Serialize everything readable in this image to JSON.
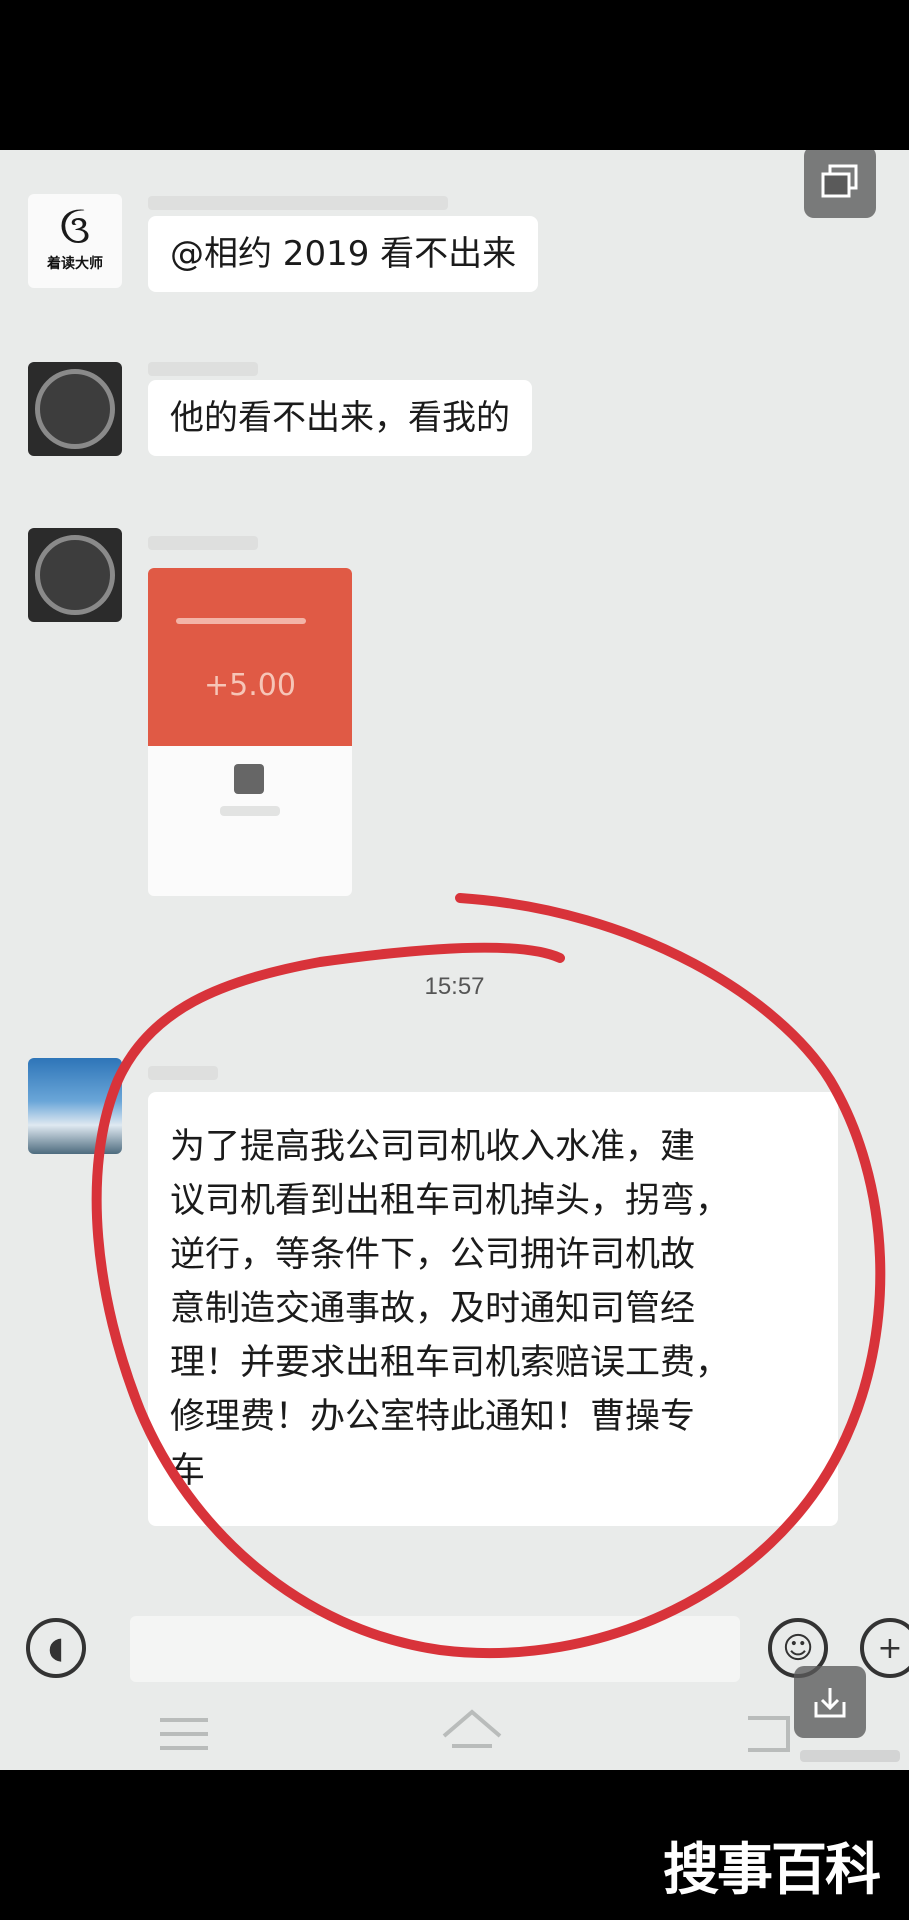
{
  "chat": {
    "messages": [
      {
        "sender": "group-member-1",
        "avatar_icon": "brand-logo-icon",
        "avatar_caption": "着读大师",
        "text": "@相约 2019 看不出来"
      },
      {
        "sender": "group-member-2",
        "avatar_icon": "dark-circle-avatar-icon",
        "text": "他的看不出来，看我的"
      },
      {
        "sender": "group-member-2",
        "type": "red-packet",
        "amount": "+5.00"
      },
      {
        "type": "timestamp",
        "text": "15:57"
      },
      {
        "sender": "group-member-3",
        "avatar_icon": "landscape-photo-avatar-icon",
        "text": "为了提高我公司司机收入水准，建\n议司机看到出租车司机掉头，拐弯，\n逆行，等条件下，公司拥许司机故\n意制造交通事故，及时通知司管经\n理！并要求出租车司机索赔误工费，\n修理费！办公室特此通知！曹操专\n车"
      }
    ]
  },
  "input_bar": {
    "voice_icon": "voice-input-icon",
    "emoji_icon": "emoji-icon",
    "plus_icon": "plus-icon"
  },
  "nav_bar": {
    "menu_icon": "menu-icon",
    "home_icon": "home-icon",
    "back_icon": "back-icon"
  },
  "overlay": {
    "multiwindow_icon": "multi-window-icon",
    "save_icon": "download-icon",
    "annotation_color": "#d8333a"
  },
  "watermark": "搜事百科"
}
